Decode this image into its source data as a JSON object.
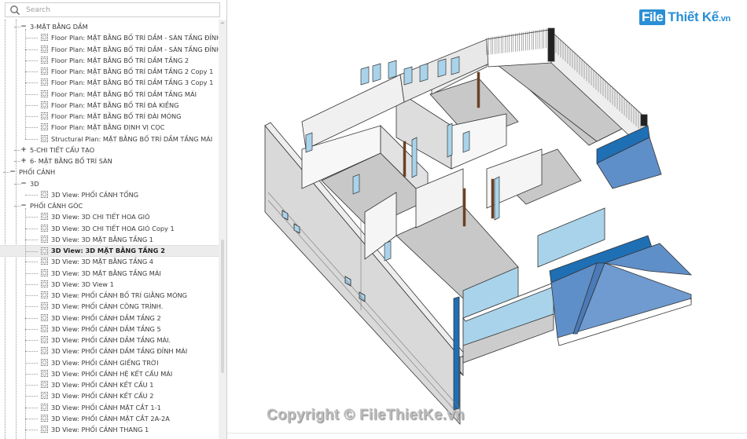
{
  "browser": {
    "search": {
      "placeholder": "Search",
      "value": ""
    },
    "tree": [
      {
        "level": 2,
        "type": "group",
        "toggle": "−",
        "label": "3-MẶT BẰNG DẦM"
      },
      {
        "level": 3,
        "type": "view",
        "label": "Floor Plan: MẶT BẰNG BỐ TRÍ DẦM - SÀN TẦNG ĐỈNH"
      },
      {
        "level": 3,
        "type": "view",
        "label": "Floor Plan: MẶT BẰNG BỐ TRÍ DẦM - SÀN TẦNG ĐỈNH"
      },
      {
        "level": 3,
        "type": "view",
        "label": "Floor Plan: MẶT BẰNG BỐ TRÍ DẦM TẦNG 2"
      },
      {
        "level": 3,
        "type": "view",
        "label": "Floor Plan: MẶT BẰNG BỐ TRÍ DẦM TẦNG 2 Copy 1"
      },
      {
        "level": 3,
        "type": "view",
        "label": "Floor Plan: MẶT BẰNG BỐ TRÍ DẦM TẦNG 3 Copy 1"
      },
      {
        "level": 3,
        "type": "view",
        "label": "Floor Plan: MẶT BẰNG BỐ TRÍ DẦM TẦNG MÁI"
      },
      {
        "level": 3,
        "type": "view",
        "label": "Floor Plan: MẶT BẰNG BỐ TRÍ ĐÀ KIỀNG"
      },
      {
        "level": 3,
        "type": "view",
        "label": "Floor Plan: MẶT BẰNG BỐ TRÍ ĐÀI MÓNG"
      },
      {
        "level": 3,
        "type": "view",
        "label": "Floor Plan: MẶT BẰNG ĐỊNH VỊ CỌC"
      },
      {
        "level": 3,
        "type": "view",
        "label": "Structural Plan: MẶT BẰNG BỐ TRÍ DẦM TẦNG MÁI"
      },
      {
        "level": 2,
        "type": "group",
        "toggle": "+",
        "label": "5-CHI TIẾT CẤU TẠO"
      },
      {
        "level": 2,
        "type": "group",
        "toggle": "+",
        "label": "6- MẶT BẰNG BỐ TRÍ SÀN"
      },
      {
        "level": 1,
        "type": "group",
        "toggle": "−",
        "label": "PHỐI CẢNH"
      },
      {
        "level": 2,
        "type": "group",
        "toggle": "−",
        "label": "3D"
      },
      {
        "level": 3,
        "type": "view",
        "label": "3D View: PHỐI CẢNH TỔNG"
      },
      {
        "level": 2,
        "type": "group",
        "toggle": "−",
        "label": "PHỐI CẢNH GÓC"
      },
      {
        "level": 3,
        "type": "view",
        "label": "3D View: 3D CHI TIẾT HOA GIÓ"
      },
      {
        "level": 3,
        "type": "view",
        "label": "3D View: 3D CHI TIẾT HOA GIÓ Copy 1"
      },
      {
        "level": 3,
        "type": "view",
        "label": "3D View: 3D MẶT BẰNG TẦNG 1"
      },
      {
        "level": 3,
        "type": "view",
        "label": "3D View: 3D MẶT BẰNG TẦNG 2",
        "selected": true
      },
      {
        "level": 3,
        "type": "view",
        "label": "3D View: 3D MẶT BẰNG TẦNG 4"
      },
      {
        "level": 3,
        "type": "view",
        "label": "3D View: 3D MẶT BẰNG TẦNG MÁI"
      },
      {
        "level": 3,
        "type": "view",
        "label": "3D View: 3D View 1"
      },
      {
        "level": 3,
        "type": "view",
        "label": "3D View: PHỐI CẢNH BỐ TRÍ GIẰNG MÓNG"
      },
      {
        "level": 3,
        "type": "view",
        "label": "3D View: PHỐI CẢNH CÔNG TRÌNH."
      },
      {
        "level": 3,
        "type": "view",
        "label": "3D View: PHỐI CẢNH DẦM TẦNG 2"
      },
      {
        "level": 3,
        "type": "view",
        "label": "3D View: PHỐI CẢNH DẦM TẦNG 5"
      },
      {
        "level": 3,
        "type": "view",
        "label": "3D View: PHỐI CẢNH DẦM TẦNG MÁI."
      },
      {
        "level": 3,
        "type": "view",
        "label": "3D View: PHỐI CẢNH DẦM TẦNG ĐỈNH MÁI"
      },
      {
        "level": 3,
        "type": "view",
        "label": "3D View: PHỐI CẢNH GIẾNG TRỜI"
      },
      {
        "level": 3,
        "type": "view",
        "label": "3D View: PHỐI CẢNH HỆ KẾT CẤU MÁI"
      },
      {
        "level": 3,
        "type": "view",
        "label": "3D View: PHỐI CẢNH KẾT CẤU 1"
      },
      {
        "level": 3,
        "type": "view",
        "label": "3D View: PHỐI CẢNH KẾT CẤU 2"
      },
      {
        "level": 3,
        "type": "view",
        "label": "3D View: PHỐI CẢNH MẶT CẮT 1-1"
      },
      {
        "level": 3,
        "type": "view",
        "label": "3D View: PHỐI CẢNH MẶT CẮT 2A-2A"
      },
      {
        "level": 3,
        "type": "view",
        "label": "3D View: PHỐI CẢNH THANG 1"
      }
    ],
    "scroll_up_glyph": "^"
  },
  "viewport": {
    "logo": {
      "box_text": "File",
      "text": "Thiết Kế",
      "tld": ".vn"
    },
    "copyright": "Copyright © FileThietKe.vn",
    "colors": {
      "wall": "#d9d9d9",
      "floor": "#c8c8c8",
      "glass": "#a9d3ea",
      "roof": "#5f8fc8",
      "fascia": "#1f6fb5",
      "frame": "#6b4226"
    }
  }
}
